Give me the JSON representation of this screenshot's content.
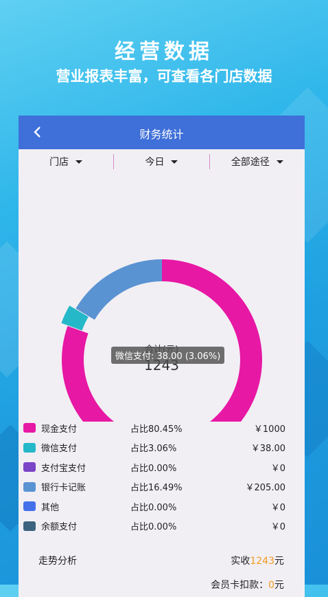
{
  "hero": {
    "title": "经营数据",
    "subtitle": "营业报表丰富，可查看各门店数据"
  },
  "appbar": {
    "title": "财务统计",
    "back_icon": "chevron-left-icon"
  },
  "filters": [
    {
      "label": "门店"
    },
    {
      "label": "今日"
    },
    {
      "label": "全部途径"
    }
  ],
  "donut": {
    "center_title": "合计(元)",
    "center_value": "1243",
    "tooltip": "微信支付: 38.00 (3.06%)",
    "slices": [
      {
        "name": "现金支付",
        "percent": 80.45,
        "color": "#e718a4"
      },
      {
        "name": "微信支付",
        "percent": 3.06,
        "color": "#25b8c9",
        "highlighted": true
      },
      {
        "name": "支付宝支付",
        "percent": 0,
        "color": "#7a45c7"
      },
      {
        "name": "银行卡记账",
        "percent": 16.49,
        "color": "#5a93d2"
      },
      {
        "name": "其他",
        "percent": 0,
        "color": "#4470ea"
      },
      {
        "name": "余额支付",
        "percent": 0,
        "color": "#3d6280"
      }
    ]
  },
  "legend": [
    {
      "name": "现金支付",
      "pct": "占比80.45%",
      "amount": "￥1000",
      "color": "#e718a4"
    },
    {
      "name": "微信支付",
      "pct": "占比3.06%",
      "amount": "￥38.00",
      "color": "#25b8c9"
    },
    {
      "name": "支付宝支付",
      "pct": "占比0.00%",
      "amount": "￥0",
      "color": "#7a45c7"
    },
    {
      "name": "银行卡记账",
      "pct": "占比16.49%",
      "amount": "￥205.00",
      "color": "#5a93d2"
    },
    {
      "name": "其他",
      "pct": "占比0.00%",
      "amount": "￥0",
      "color": "#4470ea"
    },
    {
      "name": "余额支付",
      "pct": "占比0.00%",
      "amount": "￥0",
      "color": "#3d6280"
    }
  ],
  "trend": {
    "label": "走势分析",
    "received_prefix": "实收",
    "received_value": "1243",
    "received_suffix": "元"
  },
  "member": {
    "label": "会员卡扣款：",
    "value": "0",
    "suffix": "元"
  }
}
